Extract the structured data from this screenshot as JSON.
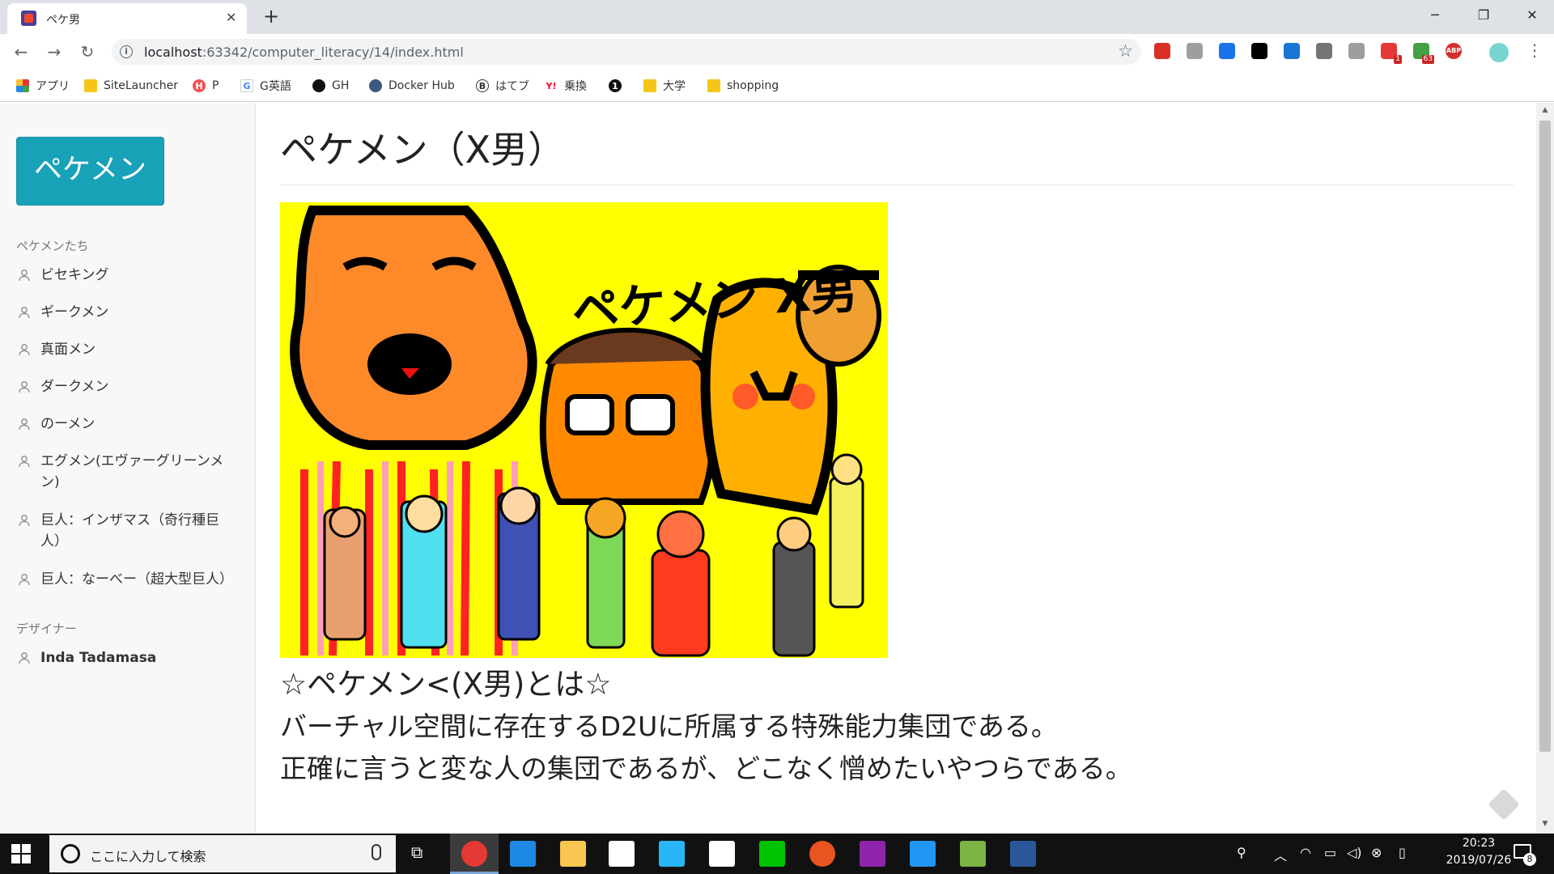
{
  "browser": {
    "tab_title": "ペケ男",
    "tab_close": "✕",
    "new_tab": "+",
    "url_host": "localhost",
    "url_rest": ":63342/computer_literacy/14/index.html",
    "window_controls": {
      "minimize": "─",
      "maximize": "❐",
      "close": "✕"
    },
    "nav": {
      "back": "←",
      "forward": "→",
      "reload": "↻"
    },
    "extensions": [
      {
        "icon": "ublock-icon",
        "color": "#d93025"
      },
      {
        "icon": "cursor-icon",
        "color": "#9e9e9e"
      },
      {
        "icon": "bitly-icon",
        "color": "#1a73e8"
      },
      {
        "icon": "jb-icon",
        "color": "#000000"
      },
      {
        "icon": "bl-icon",
        "color": "#1976d2"
      },
      {
        "icon": "md-icon",
        "color": "#757575"
      },
      {
        "icon": "shield-icon",
        "color": "#9e9e9e"
      },
      {
        "icon": "tasks-icon",
        "color": "#e53935",
        "badge": "1"
      },
      {
        "icon": "up-arrow-icon",
        "color": "#43a047",
        "badge": "63"
      },
      {
        "icon": "adblock-icon",
        "color": "#d32f2f",
        "text": "ABP"
      }
    ]
  },
  "bookmarks": [
    {
      "label": "アプリ",
      "icon": "apps-grid-icon"
    },
    {
      "label": "SiteLauncher",
      "icon": "folder-icon"
    },
    {
      "label": "P",
      "icon": "p-icon"
    },
    {
      "label": "G英語",
      "icon": "google-icon"
    },
    {
      "label": "GH",
      "icon": "github-icon"
    },
    {
      "label": "Docker Hub",
      "icon": "docker-icon"
    },
    {
      "label": "はてブ",
      "icon": "hatena-icon"
    },
    {
      "label": "乗換",
      "icon": "yahoo-icon"
    },
    {
      "label": "",
      "icon": "onepassword-icon"
    },
    {
      "label": "大学",
      "icon": "folder-icon"
    },
    {
      "label": "shopping",
      "icon": "folder-icon"
    }
  ],
  "sidebar": {
    "brand": "ペケメン",
    "section1": "ペケメンたち",
    "members": [
      "ビセキング",
      "ギークメン",
      "真面メン",
      "ダークメン",
      "のーメン",
      "エグメン(エヴァーグリーンメン)",
      "巨人：インザマス（奇行種巨人）",
      "巨人：なーべー（超大型巨人）"
    ],
    "section2": "デザイナー",
    "designer": "Inda Tadamasa"
  },
  "main": {
    "title": "ペケメン（X男）",
    "image_text": "ペケメン X男",
    "subheading": "☆ペケメン<(X男)とは☆",
    "desc_line1": "バーチャル空間に存在するD2Uに所属する特殊能力集団である。",
    "desc_line2": "正確に言うと変な人の集団であるが、どこなく憎めたいやつらである。"
  },
  "taskbar": {
    "search_placeholder": "ここに入力して検索",
    "clock_time": "20:23",
    "clock_date": "2019/07/26",
    "notification_count": "8",
    "apps": [
      {
        "icon": "chrome-icon",
        "color": "#e53935"
      },
      {
        "icon": "edge-icon",
        "color": "#1e88e5"
      },
      {
        "icon": "explorer-icon",
        "color": "#f9c74f"
      },
      {
        "icon": "store-icon",
        "color": "#ffffff"
      },
      {
        "icon": "l-app-icon",
        "color": "#29b6f6"
      },
      {
        "icon": "mail-icon",
        "color": "#ffffff"
      },
      {
        "icon": "line-icon",
        "color": "#00c300"
      },
      {
        "icon": "ubuntu-icon",
        "color": "#e95420"
      },
      {
        "icon": "intellij-icon",
        "color": "#8e24aa"
      },
      {
        "icon": "kotlin-icon",
        "color": "#2196f3"
      },
      {
        "icon": "lambda-icon",
        "color": "#7cb342"
      },
      {
        "icon": "word-icon",
        "color": "#2b579a"
      }
    ]
  }
}
